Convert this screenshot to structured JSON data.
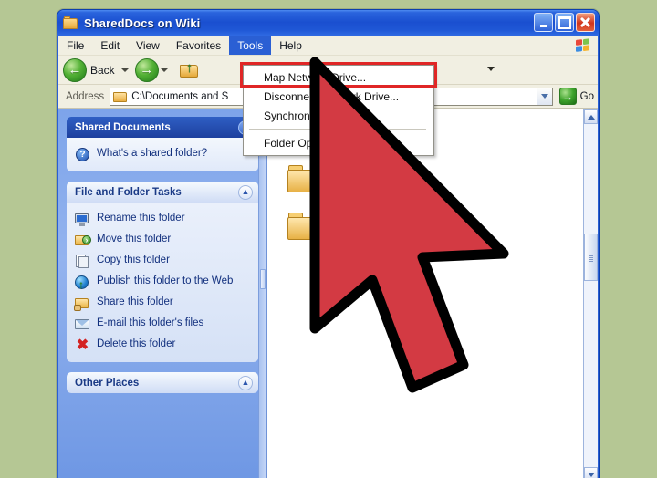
{
  "window": {
    "title": "SharedDocs on Wiki",
    "title_icon": "folder-icon",
    "buttons": {
      "minimize": "minimize-button",
      "maximize": "maximize-button",
      "close": "close-button"
    }
  },
  "menubar": {
    "items": [
      {
        "label": "File",
        "active": false
      },
      {
        "label": "Edit",
        "active": false
      },
      {
        "label": "View",
        "active": false
      },
      {
        "label": "Favorites",
        "active": false
      },
      {
        "label": "Tools",
        "active": true
      },
      {
        "label": "Help",
        "active": false
      }
    ],
    "logo": "windows-flag-icon"
  },
  "toolbar": {
    "back_label": "Back",
    "back_icon": "back-arrow-icon",
    "forward_icon": "forward-arrow-icon",
    "up_icon": "up-folder-icon",
    "overflow_icon": "chevron-down-icon"
  },
  "address": {
    "label": "Address",
    "icon": "folder-icon",
    "value": "C:\\Documents and S",
    "dropdown_icon": "chevron-down-icon",
    "go_label": "Go",
    "go_icon": "go-arrow-icon"
  },
  "dropdown": {
    "items": [
      {
        "label": "Map Network Drive...",
        "highlighted": true,
        "separator_after": false
      },
      {
        "label": "Disconnect Network Drive...",
        "highlighted": false,
        "separator_after": false
      },
      {
        "label": "Synchronize",
        "highlighted": false,
        "separator_after": true
      },
      {
        "label": "Folder Options...",
        "highlighted": false,
        "separator_after": false
      }
    ],
    "highlight_color": "#e02626"
  },
  "sidebar": {
    "panels": [
      {
        "title": "Shared Documents",
        "style": "dark",
        "collapse_icon": "chevron-up-icon",
        "items": [
          {
            "label": "What's a shared folder?",
            "icon": "help-icon"
          }
        ]
      },
      {
        "title": "File and Folder Tasks",
        "style": "light",
        "collapse_icon": "chevron-up-icon",
        "items": [
          {
            "label": "Rename this folder",
            "icon": "rename-icon"
          },
          {
            "label": "Move this folder",
            "icon": "move-folder-icon"
          },
          {
            "label": "Copy this folder",
            "icon": "copy-icon"
          },
          {
            "label": "Publish this folder to the Web",
            "icon": "publish-web-icon"
          },
          {
            "label": "Share this folder",
            "icon": "share-folder-icon"
          },
          {
            "label": "E-mail this folder's files",
            "icon": "email-icon"
          },
          {
            "label": "Delete this folder",
            "icon": "delete-icon"
          }
        ]
      },
      {
        "title": "Other Places",
        "style": "light",
        "collapse_icon": "chevron-up-icon",
        "items": []
      }
    ]
  },
  "content": {
    "files": [
      {
        "icon": "folder-icon-gray"
      },
      {
        "icon": "folder-icon"
      },
      {
        "icon": "folder-icon"
      }
    ],
    "scrollbar": {
      "up_icon": "scroll-up-icon",
      "down_icon": "scroll-down-icon"
    }
  },
  "cursor": {
    "type": "arrow-pointer",
    "fill": "#d33a43",
    "stroke": "#000000"
  },
  "colors": {
    "desktop_background": "#b5c794",
    "window_frame": "#2a5fd4",
    "titlebar_gradient_start": "#4e8bf0",
    "titlebar_gradient_end": "#2f6ae2",
    "menubar": "#f1efe2",
    "sidebar_gradient": "#7da4ea",
    "panel_header_dark": "#1d3f9e",
    "panel_label_text": "#12307e",
    "highlight_red": "#e02626"
  }
}
